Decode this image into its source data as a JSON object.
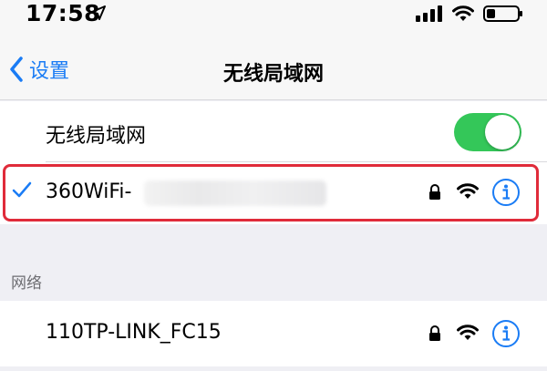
{
  "status_bar": {
    "time": "17:58",
    "icons": [
      "location-arrow-icon",
      "cellular-signal-icon",
      "wifi-signal-icon",
      "battery-icon"
    ]
  },
  "nav": {
    "back_label": "设置",
    "title": "无线局域网"
  },
  "wifi_toggle": {
    "label": "无线局域网",
    "on": true
  },
  "connected_network": {
    "name": "360WiFi-",
    "secured": true
  },
  "networks_section": {
    "header": "网络",
    "items": [
      {
        "name": "110TP-LINK_FC15",
        "secured": true
      }
    ]
  },
  "colors": {
    "accent": "#1a7cf5",
    "toggle_on": "#34c759",
    "highlight": "#e02b3a"
  }
}
